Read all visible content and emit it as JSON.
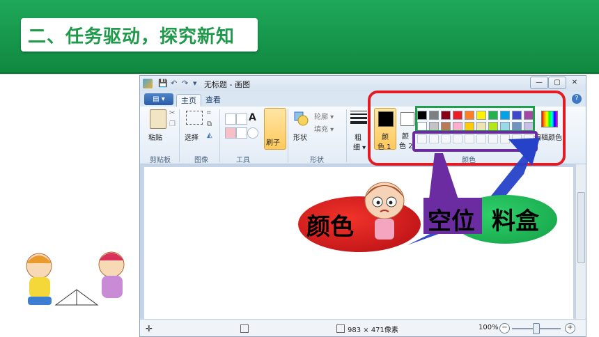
{
  "slide": {
    "title": "二、任务驱动，探究新知"
  },
  "window": {
    "title": "无标题 - 画图",
    "quick_access": [
      "💾",
      "↶",
      "↷",
      "▾"
    ],
    "controls": {
      "minimize": "—",
      "maximize": "▢",
      "close": "✕"
    }
  },
  "tabs": {
    "file_button": "▤ ▾",
    "items": [
      {
        "label": "主页"
      },
      {
        "label": "查看"
      }
    ],
    "help": "?"
  },
  "ribbon": {
    "groups": [
      {
        "label": "剪贴板"
      },
      {
        "label": "图像"
      },
      {
        "label": "工具"
      },
      {
        "label": "形状"
      },
      {
        "label": "颜色"
      }
    ],
    "paste_label": "粘贴",
    "select_label": "选择",
    "brush_label": "刷子",
    "shapes_label": "形状",
    "outline_label": "轮廓 ▾",
    "fill_label": "填充 ▾",
    "size_label_line1": "粗",
    "size_label_line2": "细 ▾",
    "color1_line1": "颜",
    "color1_line2": "色 1",
    "color2_line1": "颜",
    "color2_line2": "色 2",
    "edit_colors_label": "编辑颜色",
    "palette_row1": [
      "#000000",
      "#7f7f7f",
      "#880015",
      "#ed1c24",
      "#ff7f27",
      "#fff200",
      "#22b14c",
      "#00a2e8",
      "#3f48cc",
      "#a349a4"
    ],
    "palette_row2": [
      "#ffffff",
      "#c3c3c3",
      "#b97a57",
      "#ffaec9",
      "#ffc90e",
      "#efe4b0",
      "#b5e61d",
      "#99d9ea",
      "#7092be",
      "#c8bfe7"
    ]
  },
  "statusbar": {
    "size_text": "983 × 471像素",
    "zoom_text": "100%",
    "zoom_minus": "−",
    "zoom_plus": "+"
  },
  "annotations": {
    "color_label": "颜色",
    "empty_color_label": "空位",
    "paint_box_label": "料盒",
    "highlight_colors": {
      "red": "#e31b23",
      "green": "#1ea048",
      "purple": "#6a2ca0"
    }
  }
}
